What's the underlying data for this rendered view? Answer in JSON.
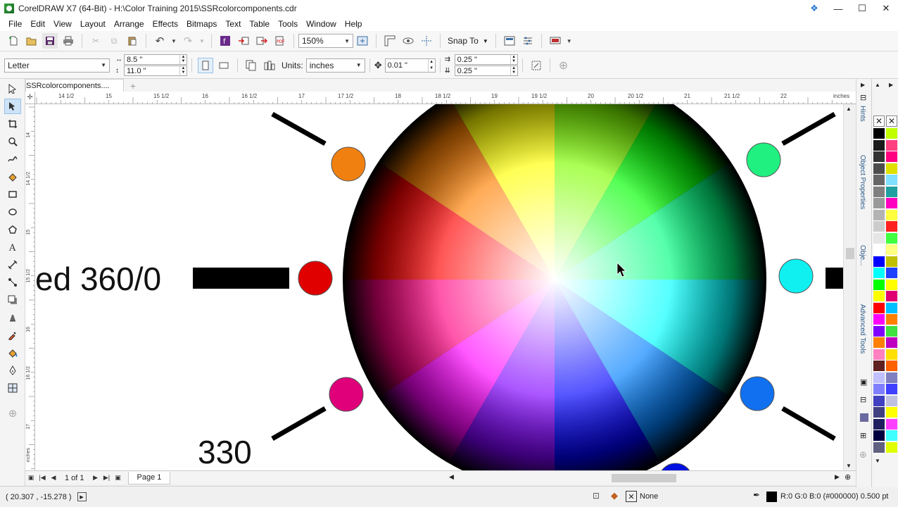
{
  "window": {
    "title": "CorelDRAW X7 (64-Bit) - H:\\Color Training 2015\\SSRcolorcomponents.cdr",
    "minimize": "—",
    "maximize": "☐",
    "close": "✕"
  },
  "menu": [
    "File",
    "Edit",
    "View",
    "Layout",
    "Arrange",
    "Effects",
    "Bitmaps",
    "Text",
    "Table",
    "Tools",
    "Window",
    "Help"
  ],
  "toolbar": {
    "zoom": "150%",
    "snap_label": "Snap To"
  },
  "property_bar": {
    "page_size": "Letter",
    "width": "8.5 \"",
    "height": "11.0 \"",
    "units_label": "Units:",
    "units_value": "inches",
    "nudge": "0.01 \"",
    "dup_x": "0.25 \"",
    "dup_y": "0.25 \""
  },
  "document_tab": "SSRcolorcomponents....",
  "ruler_h": {
    "labels": [
      "14 1/2",
      "15",
      "15 1/2",
      "16",
      "16 1/2",
      "17",
      "17 1/2",
      "18",
      "18 1/2",
      "19",
      "19 1/2",
      "20",
      "20 1/2",
      "21",
      "21 1/2",
      "22"
    ],
    "unit": "inches"
  },
  "ruler_v": {
    "labels": [
      "14",
      "14 1/2",
      "15",
      "15 1/2",
      "16",
      "16 1/2",
      "17"
    ],
    "unit": "inches"
  },
  "canvas": {
    "label_red": "ed 360/0",
    "label_330": "330",
    "dots": {
      "orange": "#f08010",
      "red": "#e00000",
      "magenta": "#e0007a",
      "spring_green": "#20f080",
      "cyan": "#10f0f0",
      "azure": "#1070f0",
      "blue": "#0010e0"
    }
  },
  "page_nav": {
    "count": "1 of 1",
    "page_tab": "Page 1"
  },
  "status": {
    "coords": "( 20.307 , -15.278 )",
    "fill_label": "None",
    "outline_info": "R:0 G:0 B:0 (#000000)  0.500 pt"
  },
  "dockers": [
    "Hints",
    "Object Properties",
    "Obje...",
    "Advanced Tools"
  ],
  "palette_colors": [
    "#000000",
    "#1a1a1a",
    "#333333",
    "#4d4d4d",
    "#666666",
    "#808080",
    "#999999",
    "#b3b3b3",
    "#cccccc",
    "#e6e6e6",
    "#ffffff",
    "#0000ff",
    "#00ffff",
    "#00ff00",
    "#ffff00",
    "#ff0000",
    "#ff00ff",
    "#8000ff",
    "#ff8000",
    "#ff80c0",
    "#602020",
    "#c0c0ff",
    "#8080ff",
    "#4040c0",
    "#404080",
    "#202060",
    "#000040",
    "#606080"
  ],
  "palette_colors_right": [
    "#c0ff00",
    "#ff4080",
    "#ff0080",
    "#e0e000",
    "#80e0ff",
    "#20a0a0",
    "#ff00c0",
    "#ffff40",
    "#ff2020",
    "#40ff40",
    "#ffff80",
    "#c0c000",
    "#2040ff",
    "#ffff00",
    "#e00070",
    "#00c0ff",
    "#ff8000",
    "#40e040",
    "#c000c0",
    "#ffe000",
    "#ff6000",
    "#8080c0",
    "#4040ff",
    "#c0c0e0",
    "#ffff00",
    "#ff40ff",
    "#40ffff",
    "#e0ff00"
  ]
}
